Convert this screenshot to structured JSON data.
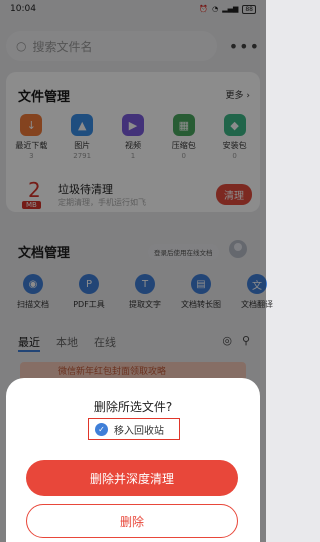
{
  "status_bar": {
    "time": "10:04",
    "battery": "88"
  },
  "search": {
    "placeholder": "搜索文件名"
  },
  "file_manager": {
    "title": "文件管理",
    "more_label": "更多",
    "categories": [
      {
        "label": "最近下载",
        "count": "3",
        "icon": "download-icon",
        "color": "#f07a3a"
      },
      {
        "label": "图片",
        "count": "2791",
        "icon": "image-icon",
        "color": "#3a8ee8"
      },
      {
        "label": "视频",
        "count": "1",
        "icon": "video-icon",
        "color": "#7a5cdc"
      },
      {
        "label": "压缩包",
        "count": "0",
        "icon": "archive-icon",
        "color": "#4aa860"
      },
      {
        "label": "安装包",
        "count": "0",
        "icon": "package-icon",
        "color": "#3db888"
      }
    ],
    "junk": {
      "number": "2",
      "unit": "MB",
      "title": "垃圾待清理",
      "subtitle": "定期清理，手机运行如飞",
      "button": "清理"
    }
  },
  "doc_manager": {
    "title": "文档管理",
    "login_chip": "登录后使用在线文档",
    "tools": [
      {
        "label": "扫描文档",
        "icon": "scan-icon"
      },
      {
        "label": "PDF工具",
        "icon": "pdf-icon"
      },
      {
        "label": "提取文字",
        "icon": "text-extract-icon"
      },
      {
        "label": "文档转长图",
        "icon": "long-image-icon"
      },
      {
        "label": "文档翻译",
        "icon": "translate-icon"
      }
    ],
    "tabs": [
      "最近",
      "本地",
      "在线"
    ]
  },
  "banner": {
    "text": "微信新年红包封面领取攻略"
  },
  "dialog": {
    "title": "删除所选文件?",
    "recycle_label": "移入回收站",
    "deep_clean_button": "删除并深度清理",
    "delete_button": "删除"
  }
}
